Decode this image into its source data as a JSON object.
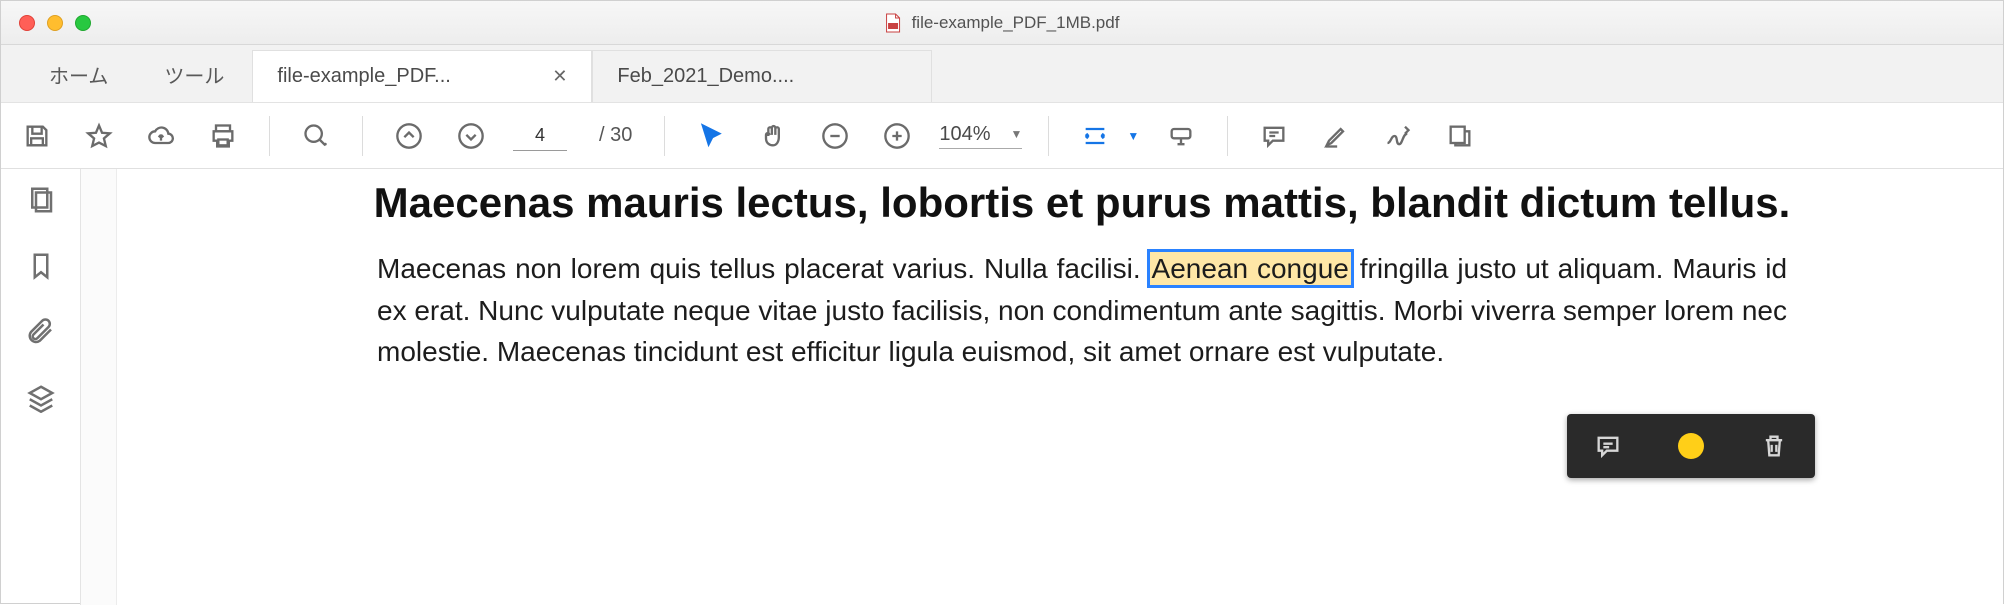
{
  "window": {
    "title": "file-example_PDF_1MB.pdf"
  },
  "tabs": {
    "home": "ホーム",
    "tools": "ツール",
    "docs": [
      {
        "label": "file-example_PDF...",
        "active": true
      },
      {
        "label": "Feb_2021_Demo....",
        "active": false
      }
    ]
  },
  "toolbar": {
    "page_current": "4",
    "page_total": "/ 30",
    "zoom": "104%"
  },
  "document": {
    "heading": "Maecenas mauris lectus, lobortis et purus mattis, blandit dictum tellus.",
    "para_before": "Maecenas non lorem quis tellus placerat varius. Nulla facilisi. ",
    "highlighted": "Aenean congue",
    "para_after": " fringilla justo ut aliquam. Mauris id ex erat. Nunc vulputate neque vitae justo facilisis, non condimentum ante sagittis. Morbi viverra semper lorem nec molestie. Maecenas tincidunt est efficitur ligula euismod, sit amet ornare est vulputate."
  },
  "annot_popup": {
    "color": "#ffcf18"
  }
}
